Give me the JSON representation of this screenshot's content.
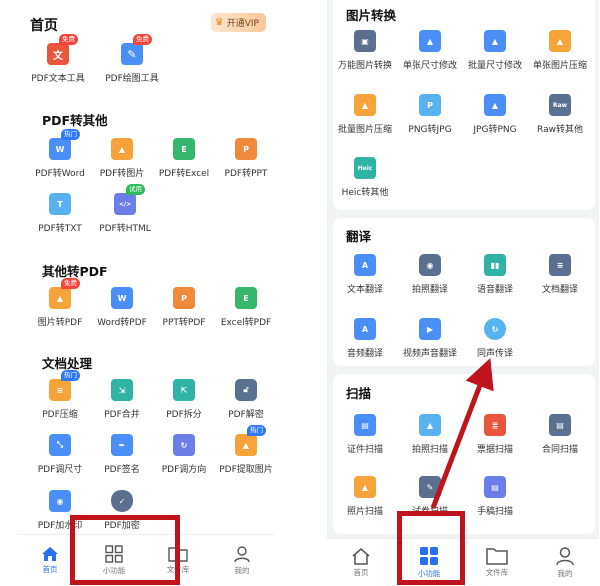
{
  "left": {
    "title": "首页",
    "vip_label": "开通VIP",
    "tools_row": [
      {
        "label": "PDF文本工具",
        "badge": "免费"
      },
      {
        "label": "PDF绘图工具",
        "badge": "免费"
      }
    ],
    "section_pdf_to": {
      "title": "PDF转其他",
      "items": [
        {
          "label": "PDF转Word",
          "badge": "热门",
          "glyph": "W"
        },
        {
          "label": "PDF转图片",
          "glyph": ""
        },
        {
          "label": "PDF转Excel",
          "glyph": "E"
        },
        {
          "label": "PDF转PPT",
          "glyph": "P"
        },
        {
          "label": "PDF转TXT",
          "glyph": "T"
        },
        {
          "label": "PDF转HTML",
          "badge": "试用",
          "glyph": "</>"
        }
      ]
    },
    "section_to_pdf": {
      "title": "其他转PDF",
      "items": [
        {
          "label": "图片转PDF",
          "badge": "免费",
          "glyph": ""
        },
        {
          "label": "Word转PDF",
          "glyph": "W"
        },
        {
          "label": "PPT转PDF",
          "glyph": "P"
        },
        {
          "label": "Excel转PDF",
          "glyph": "E"
        }
      ]
    },
    "section_docs": {
      "title": "文档处理",
      "items": [
        {
          "label": "PDF压缩",
          "badge": "热门"
        },
        {
          "label": "PDF合并"
        },
        {
          "label": "PDF拆分"
        },
        {
          "label": "PDF解密"
        },
        {
          "label": "PDF调尺寸"
        },
        {
          "label": "PDF签名"
        },
        {
          "label": "PDF调方向"
        },
        {
          "label": "PDF提取图片",
          "badge": "热门"
        },
        {
          "label": "PDF加水印"
        },
        {
          "label": "PDF加密"
        }
      ]
    },
    "nav": [
      {
        "label": "首页",
        "icon": "home-icon",
        "active": true
      },
      {
        "label": "小功能",
        "icon": "grid-icon",
        "active": false
      },
      {
        "label": "文件库",
        "icon": "folder-icon",
        "active": false
      },
      {
        "label": "我的",
        "icon": "user-icon",
        "active": false
      }
    ]
  },
  "right": {
    "section_image": {
      "title": "图片转换",
      "items": [
        {
          "label": "万能图片转换"
        },
        {
          "label": "单张尺寸修改"
        },
        {
          "label": "批量尺寸修改"
        },
        {
          "label": "单张图片压缩"
        },
        {
          "label": "批量图片压缩"
        },
        {
          "label": "PNG转JPG",
          "glyph": "P"
        },
        {
          "label": "JPG转PNG"
        },
        {
          "label": "Raw转其他",
          "glyph": "Raw"
        },
        {
          "label": "Heic转其他",
          "glyph": "Heic"
        }
      ]
    },
    "section_translate": {
      "title": "翻译",
      "items": [
        {
          "label": "文本翻译",
          "glyph": "A"
        },
        {
          "label": "拍照翻译"
        },
        {
          "label": "语音翻译"
        },
        {
          "label": "文档翻译"
        },
        {
          "label": "音频翻译",
          "glyph": "A"
        },
        {
          "label": "视频声音翻译"
        },
        {
          "label": "同声传译"
        }
      ]
    },
    "section_scan": {
      "title": "扫描",
      "items": [
        {
          "label": "证件扫描"
        },
        {
          "label": "拍照扫描"
        },
        {
          "label": "票据扫描"
        },
        {
          "label": "合同扫描"
        },
        {
          "label": "照片扫描"
        },
        {
          "label": "试卷扫描"
        },
        {
          "label": "手稿扫描"
        }
      ]
    },
    "nav": [
      {
        "label": "首页",
        "icon": "home-icon",
        "active": false
      },
      {
        "label": "小功能",
        "icon": "grid-icon",
        "active": true
      },
      {
        "label": "文件库",
        "icon": "folder-icon",
        "active": false
      },
      {
        "label": "我的",
        "icon": "user-icon",
        "active": false
      }
    ]
  },
  "colors": {
    "accent": "#2a6ff0",
    "annotation": "#c0141c",
    "badge_free": "#f2453d",
    "badge_hot": "#2f79f5",
    "badge_trial": "#2fba5a"
  }
}
